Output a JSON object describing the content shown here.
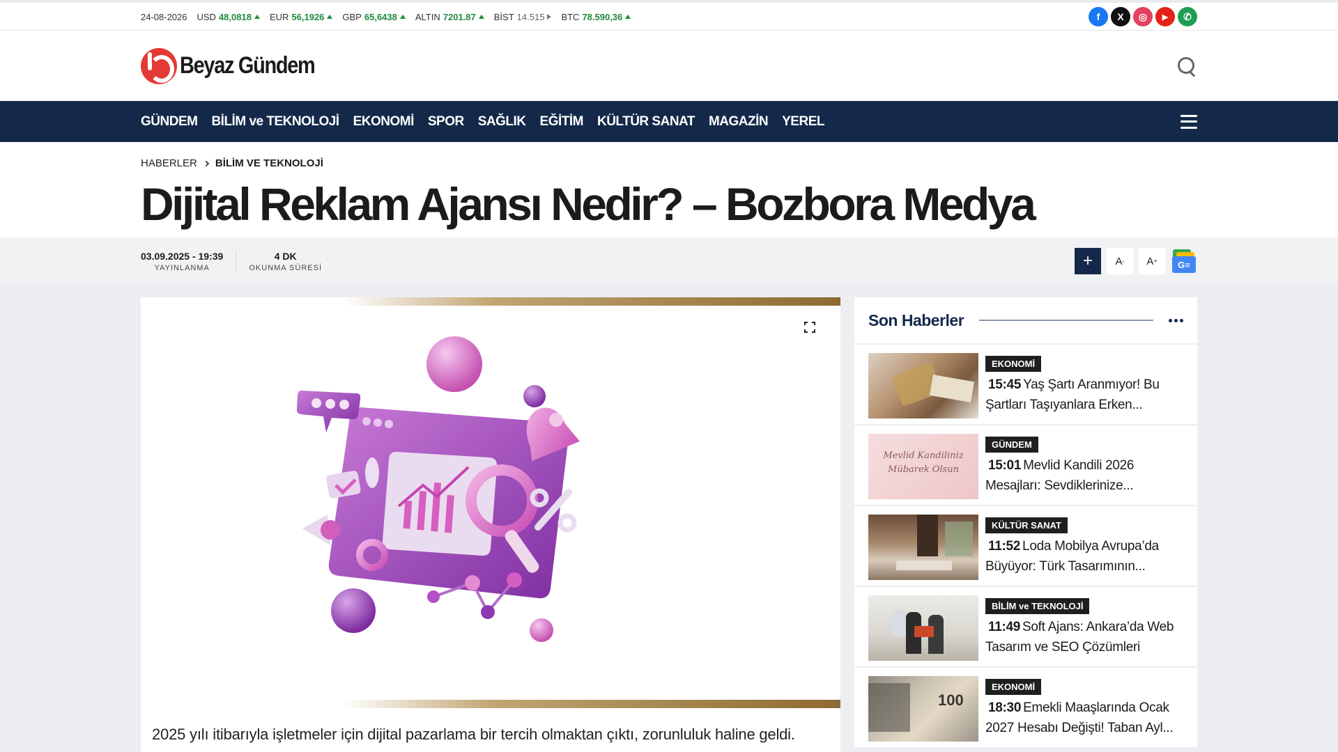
{
  "ticker": {
    "date": "24-08-2026",
    "items": [
      {
        "label": "USD",
        "value": "48,0818",
        "trend": "up"
      },
      {
        "label": "EUR",
        "value": "56,1926",
        "trend": "up"
      },
      {
        "label": "GBP",
        "value": "65,6438",
        "trend": "up"
      },
      {
        "label": "ALTIN",
        "value": "7201.87",
        "trend": "up"
      },
      {
        "label": "BİST",
        "value": "14.515",
        "trend": "flat"
      },
      {
        "label": "BTC",
        "value": "78.590,36",
        "trend": "up"
      }
    ]
  },
  "socials": [
    {
      "name": "facebook-icon",
      "glyph": "f",
      "color": "#1877f2"
    },
    {
      "name": "x-twitter-icon",
      "glyph": "X",
      "color": "#111111"
    },
    {
      "name": "instagram-icon",
      "glyph": "◎",
      "color": "#e4405f"
    },
    {
      "name": "youtube-icon",
      "glyph": "▶",
      "color": "#e62117"
    },
    {
      "name": "whatsapp-icon",
      "glyph": "✆",
      "color": "#1f9d55"
    }
  ],
  "logo": {
    "text": "Beyaz Gündem"
  },
  "nav": {
    "items": [
      "GÜNDEM",
      "BİLİM ve TEKNOLOJİ",
      "EKONOMİ",
      "SPOR",
      "SAĞLIK",
      "EĞİTİM",
      "KÜLTÜR SANAT",
      "MAGAZİN",
      "YEREL"
    ]
  },
  "breadcrumb": {
    "home": "HABERLER",
    "category": "BİLİM VE TEKNOLOJİ"
  },
  "article": {
    "title": "Dijital Reklam Ajansı Nedir? – Bozbora Medya",
    "published": "03.09.2025 - 19:39",
    "published_label": "YAYINLANMA",
    "read_time": "4 DK",
    "read_time_label": "OKUNMA SÜRESİ",
    "lead": "2025 yılı itibarıyla işletmeler için dijital pazarlama bir tercih olmaktan çıktı, zorunluluk haline geldi."
  },
  "tools": {
    "plus": "+",
    "font_down": "A",
    "font_down_sup": "-",
    "font_up": "A",
    "font_up_sup": "+",
    "gnews": "G≡"
  },
  "sidebar": {
    "title": "Son Haberler",
    "items": [
      {
        "category": "EKONOMİ",
        "time": "15:45",
        "text": "Yaş Şartı Aranmıyor! Bu Şartları Taşıyanlara Erken..."
      },
      {
        "category": "GÜNDEM",
        "time": "15:01",
        "text": "Mevlid Kandili 2026 Mesajları: Sevdiklerinize...",
        "thumb_text": "Mevlid Kandiliniz Mübarek Olsun"
      },
      {
        "category": "KÜLTÜR SANAT",
        "time": "11:52",
        "text": "Loda Mobilya Avrupa’da Büyüyor: Türk Tasarımının..."
      },
      {
        "category": "BİLİM ve TEKNOLOJİ",
        "time": "11:49",
        "text": "Soft Ajans: Ankara’da Web Tasarım ve SEO Çözümleri"
      },
      {
        "category": "EKONOMİ",
        "time": "18:30",
        "text": "Emekli Maaşlarında Ocak 2027 Hesabı Değişti! Taban Ayl...",
        "thumb_text": "100"
      }
    ]
  }
}
